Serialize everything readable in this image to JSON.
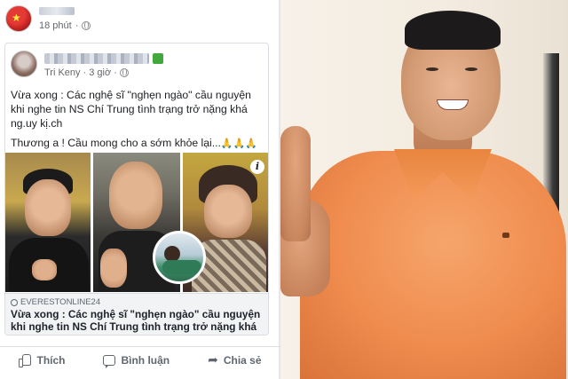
{
  "outer_post": {
    "author_name_blurred": "",
    "time": "18 phút"
  },
  "shared_post": {
    "author_name_blurred": "",
    "author_tag": "Tri Keny",
    "time": "3 giờ",
    "text_line1": "Vừa xong : Các nghệ sĩ \"nghẹn ngào\" cầu nguyện khi nghe tin NS Chí Trung tình trạng trở nặng khá ng.uy kị.ch",
    "text_line2": "Thương a ! Cầu mong cho a sớm khỏe lại...",
    "text_emoji": "🙏🙏🙏"
  },
  "link_preview": {
    "domain": "EVERESTONLINE24",
    "title": "Vừa xong : Các nghệ sĩ \"nghẹn ngào\" cầu nguyện khi nghe tin NS Chí Trung tình trạng trở nặng khá ng.uy kị.ch"
  },
  "actions": {
    "like": "Thích",
    "comment": "Bình luận",
    "share": "Chia sẻ"
  },
  "colors": {
    "fb_link": "#385898",
    "meta_gray": "#65676b",
    "shirt_orange": "#ef8b4d"
  },
  "icons": [
    "globe-icon",
    "info-icon",
    "link-icon",
    "like-icon",
    "comment-icon",
    "share-icon"
  ]
}
